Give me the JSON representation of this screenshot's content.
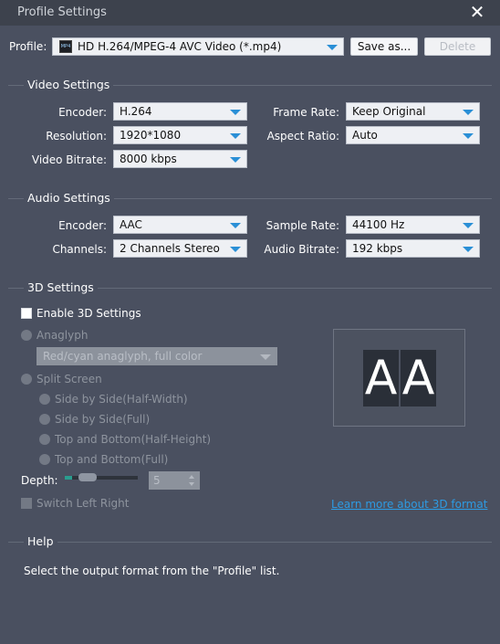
{
  "window": {
    "title": "Profile Settings"
  },
  "profile": {
    "label": "Profile:",
    "value": "HD H.264/MPEG-4 AVC Video (*.mp4)",
    "icon": "mp4-file-icon",
    "save_as": "Save as...",
    "delete": "Delete"
  },
  "video": {
    "title": "Video Settings",
    "encoder_label": "Encoder:",
    "encoder": "H.264",
    "resolution_label": "Resolution:",
    "resolution": "1920*1080",
    "bitrate_label": "Video Bitrate:",
    "bitrate": "8000 kbps",
    "framerate_label": "Frame Rate:",
    "framerate": "Keep Original",
    "aspect_label": "Aspect Ratio:",
    "aspect": "Auto"
  },
  "audio": {
    "title": "Audio Settings",
    "encoder_label": "Encoder:",
    "encoder": "AAC",
    "channels_label": "Channels:",
    "channels": "2 Channels Stereo",
    "samplerate_label": "Sample Rate:",
    "samplerate": "44100 Hz",
    "bitrate_label": "Audio Bitrate:",
    "bitrate": "192 kbps"
  },
  "three_d": {
    "title": "3D Settings",
    "enable": "Enable 3D Settings",
    "anaglyph": "Anaglyph",
    "anaglyph_mode": "Red/cyan anaglyph, full color",
    "split_screen": "Split Screen",
    "options": [
      "Side by Side(Half-Width)",
      "Side by Side(Full)",
      "Top and Bottom(Half-Height)",
      "Top and Bottom(Full)"
    ],
    "depth_label": "Depth:",
    "depth_value": "5",
    "switch": "Switch Left Right",
    "learn_more": "Learn more about 3D format",
    "preview_letters": [
      "A",
      "A"
    ]
  },
  "help": {
    "title": "Help",
    "text": "Select the output format from the \"Profile\" list."
  },
  "colors": {
    "background": "#4a5060",
    "accent": "#2a8fd6",
    "link": "#2d9be3"
  }
}
